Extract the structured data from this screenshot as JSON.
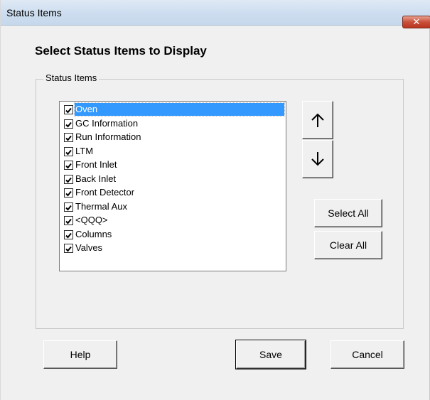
{
  "window": {
    "title": "Status Items",
    "close_label": "✕"
  },
  "heading": "Select Status Items to Display",
  "group": {
    "label": "Status Items"
  },
  "list": {
    "items": [
      {
        "label": "Oven",
        "checked": true,
        "selected": true
      },
      {
        "label": "GC Information",
        "checked": true,
        "selected": false
      },
      {
        "label": "Run Information",
        "checked": true,
        "selected": false
      },
      {
        "label": "LTM",
        "checked": true,
        "selected": false
      },
      {
        "label": "Front Inlet",
        "checked": true,
        "selected": false
      },
      {
        "label": "Back Inlet",
        "checked": true,
        "selected": false
      },
      {
        "label": "Front Detector",
        "checked": true,
        "selected": false
      },
      {
        "label": "Thermal Aux",
        "checked": true,
        "selected": false
      },
      {
        "label": "<QQQ>",
        "checked": true,
        "selected": false
      },
      {
        "label": "Columns",
        "checked": true,
        "selected": false
      },
      {
        "label": "Valves",
        "checked": true,
        "selected": false
      }
    ]
  },
  "buttons": {
    "move_up_icon": "arrow-up",
    "move_down_icon": "arrow-down",
    "select_all": "Select All",
    "clear_all": "Clear All",
    "help": "Help",
    "save": "Save",
    "cancel": "Cancel"
  },
  "colors": {
    "selection": "#3399ff",
    "close_button": "#c9503a"
  }
}
